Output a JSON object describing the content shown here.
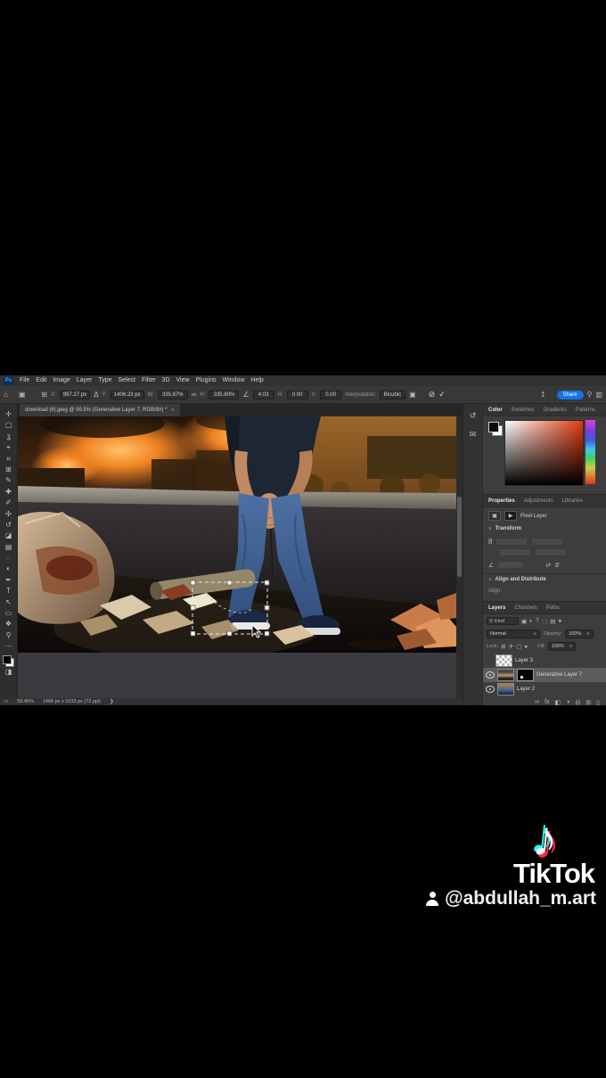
{
  "menubar": {
    "ps": "Ps",
    "items": [
      "File",
      "Edit",
      "Image",
      "Layer",
      "Type",
      "Select",
      "Filter",
      "3D",
      "View",
      "Plugins",
      "Window",
      "Help"
    ]
  },
  "options": {
    "x_label": "X:",
    "x_value": "997.27 px",
    "delta": "Δ",
    "y_label": "Y:",
    "y_value": "1406.23 px",
    "w_label": "W:",
    "w_value": "335.87%",
    "h_label": "H:",
    "h_value": "335.90%",
    "angle_value": "4.03",
    "h_skew_label": "H:",
    "h_skew_value": "0.00",
    "v_skew_label": "V:",
    "v_skew_value": "0.00",
    "interpolation_label": "Interpolation:",
    "interpolation_value": "Bicubic",
    "share_label": "Share"
  },
  "document_tab": {
    "title": "download (6).jpeg @ 59.5% (Generative Layer 7, RGB/8#) *",
    "close": "×"
  },
  "toolbar": {
    "tools": [
      {
        "name": "move-tool",
        "glyph": "✛"
      },
      {
        "name": "marquee-tool",
        "glyph": "▢"
      },
      {
        "name": "lasso-tool",
        "glyph": "ʓ"
      },
      {
        "name": "object-selection-tool",
        "glyph": "⌖"
      },
      {
        "name": "crop-tool",
        "glyph": "⌗"
      },
      {
        "name": "frame-tool",
        "glyph": "⊞"
      },
      {
        "name": "eyedropper-tool",
        "glyph": "✎"
      },
      {
        "name": "healing-brush-tool",
        "glyph": "✚"
      },
      {
        "name": "brush-tool",
        "glyph": "✐"
      },
      {
        "name": "clone-stamp-tool",
        "glyph": "✣"
      },
      {
        "name": "history-brush-tool",
        "glyph": "↺"
      },
      {
        "name": "eraser-tool",
        "glyph": "◪"
      },
      {
        "name": "gradient-tool",
        "glyph": "▤"
      },
      {
        "name": "blur-tool",
        "glyph": "◌"
      },
      {
        "name": "dodge-tool",
        "glyph": "◐"
      },
      {
        "name": "pen-tool",
        "glyph": "✒"
      },
      {
        "name": "type-tool",
        "glyph": "T"
      },
      {
        "name": "path-selection-tool",
        "glyph": "↖"
      },
      {
        "name": "rectangle-tool",
        "glyph": "▭"
      },
      {
        "name": "hand-tool",
        "glyph": "❖"
      },
      {
        "name": "zoom-tool",
        "glyph": "⚲"
      },
      {
        "name": "edit-toolbar",
        "glyph": "⋯"
      }
    ],
    "quick_mask_glyph": "◨"
  },
  "status": {
    "zoom": "59.46%",
    "info": "1466 px x 1033 px (72 ppi)"
  },
  "dock_strip": {
    "history_glyph": "↺",
    "comments_glyph": "✉"
  },
  "panels": {
    "color": {
      "tabs": [
        "Color",
        "Swatches",
        "Gradients",
        "Patterns"
      ]
    },
    "properties": {
      "tabs": [
        "Properties",
        "Adjustments",
        "Libraries"
      ],
      "layer_type": "Pixel Layer",
      "transform_label": "Transform",
      "align_label": "Align and Distribute",
      "align_sub": "Align:",
      "caret": "∨"
    },
    "layers": {
      "tabs": [
        "Layers",
        "Channels",
        "Paths"
      ],
      "search_label": "Kind",
      "search_glyph": "⚲",
      "filter_icons": [
        "▣",
        "◐",
        "T",
        "⬚",
        "▤",
        "●"
      ],
      "blend_mode": "Normal",
      "opacity_label": "Opacity:",
      "opacity_value": "100%",
      "lock_label": "Lock:",
      "lock_icons": [
        "⊞",
        "✛",
        "▢",
        "●"
      ],
      "fill_label": "Fill:",
      "fill_value": "100%",
      "dropdown_caret": "∨",
      "rows": [
        {
          "name": "Layer 3"
        },
        {
          "name": "Generative Layer 7"
        },
        {
          "name": "Layer 2"
        }
      ],
      "bottom_icons": [
        "∞",
        "fx",
        "◧",
        "◑",
        "⊟",
        "⊞",
        "▯"
      ]
    }
  },
  "tiktok": {
    "note_glyph": "♪",
    "wordmark": "TikTok",
    "username": "@abdullah_m.art",
    "color_cyan": "#25f4ee",
    "color_pink": "#fe2c55"
  },
  "colors": {
    "accent_blue": "#1473e6",
    "pasteboard": "#3b3b3f",
    "panel_bg": "#3d3d3d"
  }
}
